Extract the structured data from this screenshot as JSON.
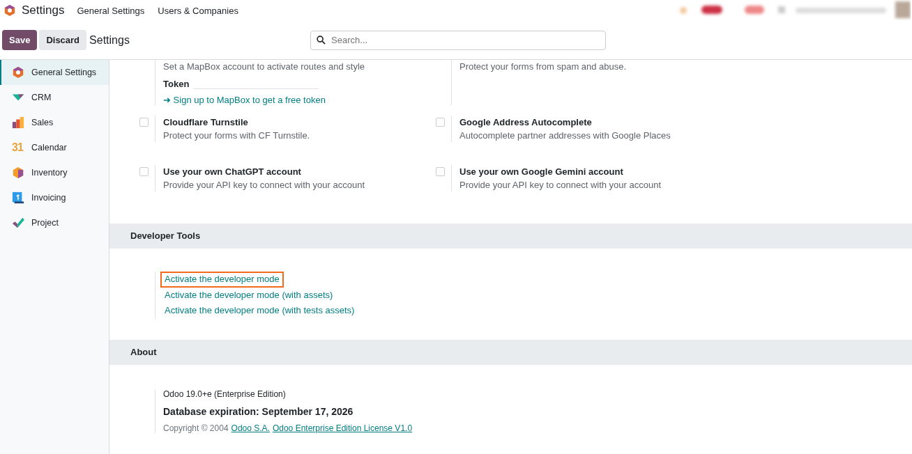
{
  "navbar": {
    "app_title": "Settings",
    "menu": [
      "General Settings",
      "Users & Companies"
    ]
  },
  "control_panel": {
    "buttons": [
      {
        "label": "Save",
        "kind": "primary"
      },
      {
        "label": "Discard",
        "kind": "secondary"
      }
    ],
    "breadcrumb": "Settings",
    "search": {
      "placeholder": "Search..."
    }
  },
  "sidebar": {
    "items": [
      {
        "label": "General Settings",
        "kind": "settings",
        "selected": true
      },
      {
        "label": "CRM",
        "kind": "crm",
        "selected": false
      },
      {
        "label": "Sales",
        "kind": "sales",
        "selected": false
      },
      {
        "label": "Calendar",
        "kind": "calendar",
        "icon_text": "31",
        "selected": false
      },
      {
        "label": "Inventory",
        "kind": "inventory",
        "selected": false
      },
      {
        "label": "Invoicing",
        "kind": "invoicing",
        "selected": false
      },
      {
        "label": "Project",
        "kind": "project",
        "selected": false
      }
    ]
  },
  "top_block": {
    "left": {
      "description": "Set a MapBox account to activate routes and style",
      "field_label": "Token",
      "link": "➜ Sign up to MapBox to get a free token"
    },
    "right": {
      "description": "Protect your forms from spam and abuse."
    }
  },
  "options": [
    {
      "title": "Cloudflare Turnstile",
      "description": "Protect your forms with CF Turnstile.",
      "checked": false
    },
    {
      "title": "Google Address Autocomplete",
      "description": "Autocomplete partner addresses with Google Places",
      "checked": false
    },
    {
      "title": "Use your own ChatGPT account",
      "description": "Provide your API key to connect with your account",
      "checked": false
    },
    {
      "title": "Use your own Google Gemini account",
      "description": "Provide your API key to connect with your account",
      "checked": false
    }
  ],
  "developer_tools": {
    "title": "Developer Tools",
    "links": [
      {
        "label": "Activate the developer mode",
        "highlighted": true
      },
      {
        "label": "Activate the developer mode (with assets)",
        "highlighted": false
      },
      {
        "label": "Activate the developer mode (with tests assets)",
        "highlighted": false
      }
    ]
  },
  "about": {
    "title": "About",
    "version": "Odoo 19.0+e (Enterprise Edition)",
    "expiration": "Database expiration: September 17, 2026",
    "copyright": "Copyright © 2004",
    "links": [
      "Odoo S.A.",
      "Odoo Enterprise Edition License V1.0"
    ]
  }
}
